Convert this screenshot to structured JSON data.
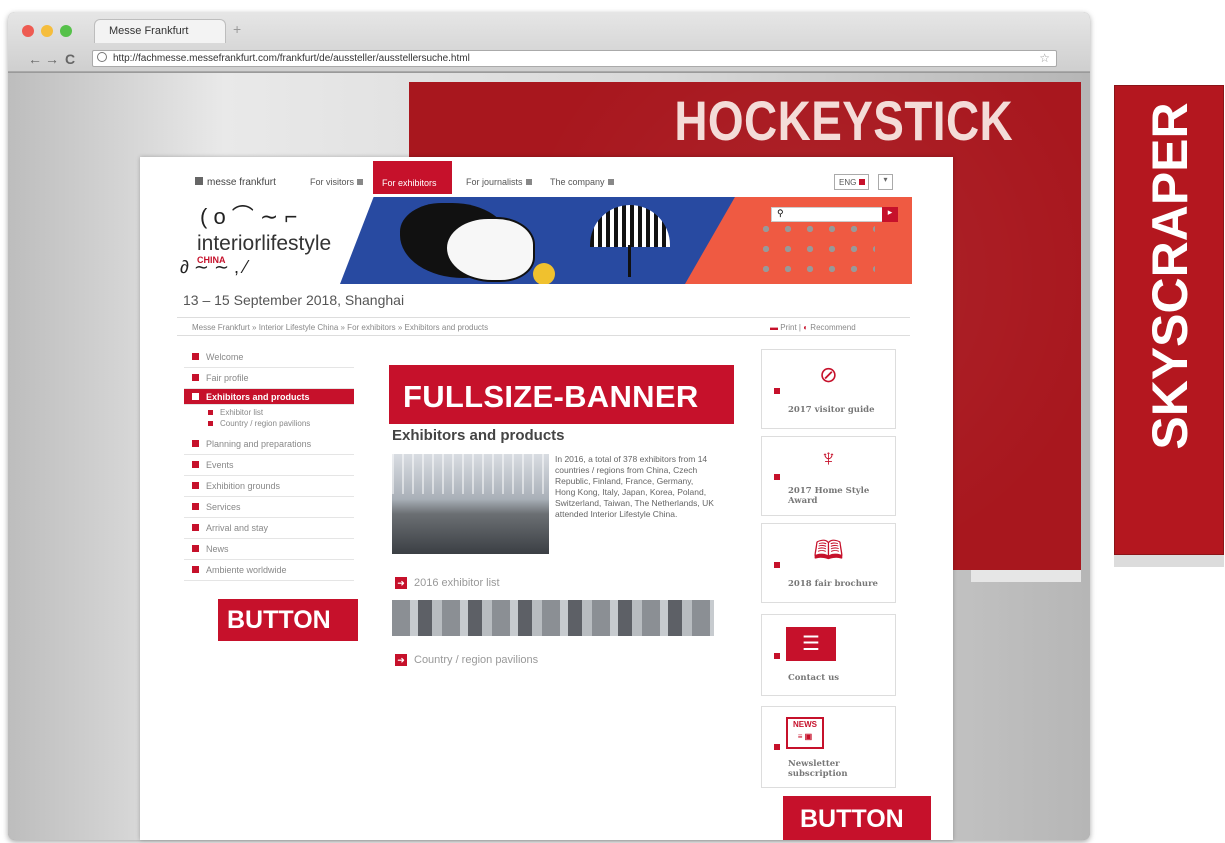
{
  "browser": {
    "tab_title": "Messe Frankfurt",
    "url": "http://fachmesse.messefrankfurt.com/frankfurt/de/aussteller/ausstellersuche.html",
    "new_tab_symbol": "+",
    "back": "←",
    "forward": "→",
    "reload": "C",
    "bookmark": "☆"
  },
  "ads": {
    "hockeystick": "HOCKEYSTICK",
    "skyscraper": "SKYSCRAPER",
    "fullsize_banner": "FULLSIZE-BANNER",
    "button_left": "BUTTON",
    "button_right": "BUTTON",
    "brand_color": "#c6112b"
  },
  "site": {
    "logo": "messe frankfurt",
    "nav": [
      "For visitors",
      "For exhibitors",
      "For journalists",
      "The company"
    ],
    "language": "ENG",
    "hero": {
      "title": "interiorlifestyle",
      "subtitle": "CHINA"
    },
    "date": "13 – 15 September 2018, Shanghai",
    "breadcrumb": "Messe Frankfurt » Interior Lifestyle China » For exhibitors » Exhibitors and products",
    "print": "Print",
    "recommend": "Recommend"
  },
  "sidebar": {
    "items": [
      "Welcome",
      "Fair profile",
      "Exhibitors and products",
      "Planning and preparations",
      "Events",
      "Exhibition grounds",
      "Services",
      "Arrival and stay",
      "News",
      "Ambiente worldwide"
    ],
    "subitems": [
      "Exhibitor list",
      "Country / region pavilions"
    ]
  },
  "main": {
    "title": "Exhibitors and products",
    "description": "In 2016, a total of 378 exhibitors from 14 countries / regions from China, Czech Republic, Finland, France, Germany, Hong Kong, Italy, Japan, Korea, Poland, Switzerland, Taiwan, The Netherlands, UK attended Interior Lifestyle China.",
    "link_1": "2016 exhibitor list",
    "link_2": "Country / region pavilions"
  },
  "tiles": [
    {
      "label": "2017 visitor guide",
      "icon": "compass-icon"
    },
    {
      "label": "2017 Home Style Award",
      "icon": "trophy-icon"
    },
    {
      "label": "2018 fair brochure",
      "icon": "book-icon"
    },
    {
      "label": "Contact us",
      "icon": "contact-card-icon"
    },
    {
      "label": "Newsletter subscription",
      "icon": "newsletter-icon"
    }
  ]
}
